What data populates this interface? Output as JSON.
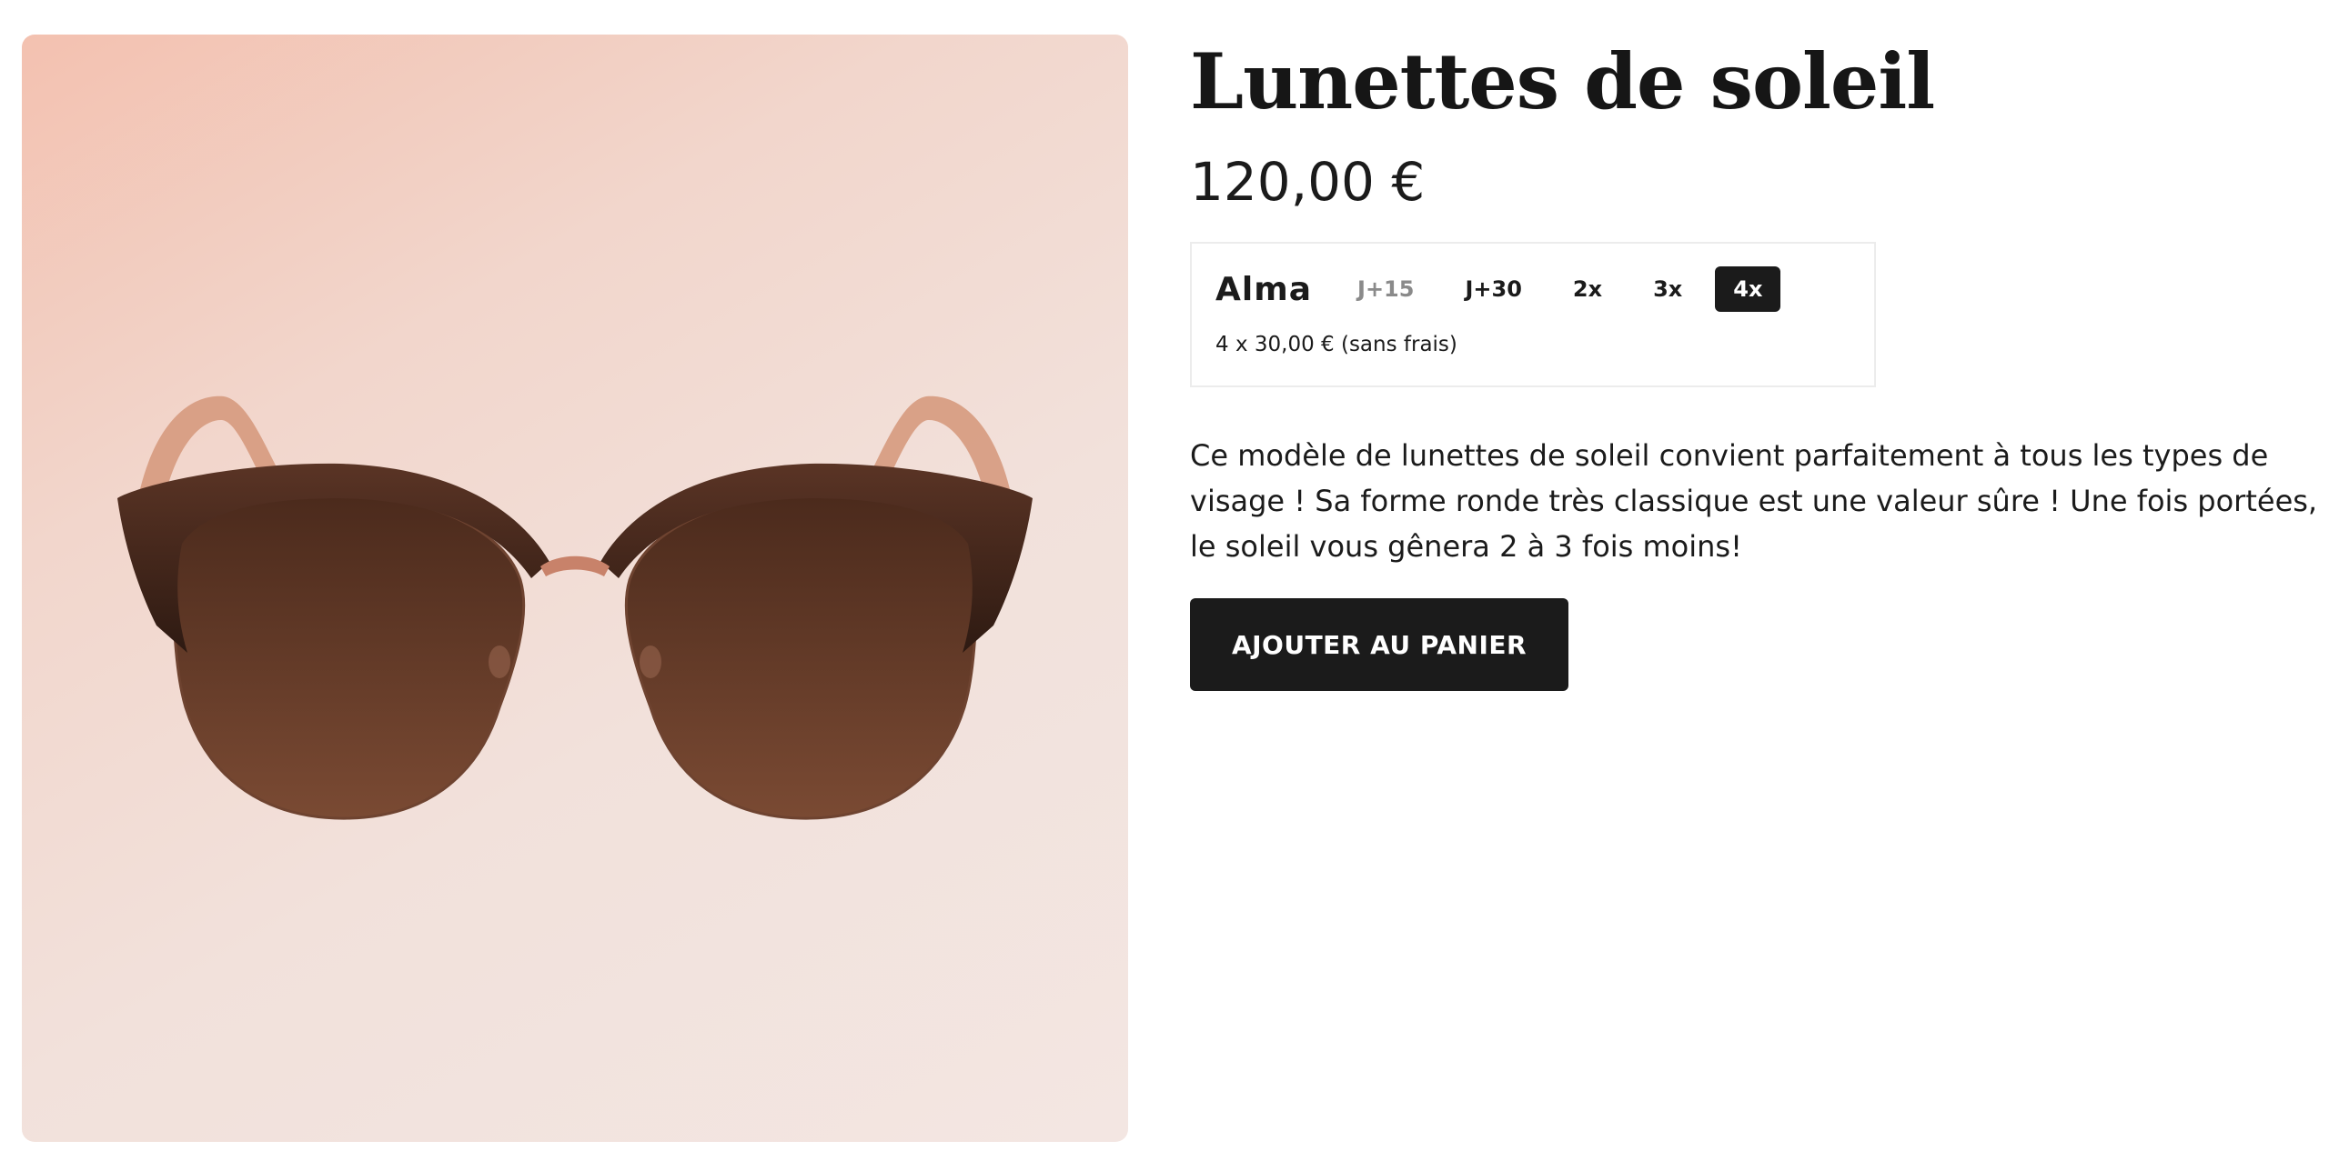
{
  "product": {
    "title": "Lunettes de soleil",
    "price": "120,00 €",
    "image_icon": "sunglasses-image",
    "description": "Ce modèle de lunettes de soleil convient parfaitement à tous les types de visage ! Sa forme ronde très classique est une valeur sûre ! Une fois portées, le soleil vous gênera 2 à 3 fois moins!"
  },
  "alma": {
    "logo": "Alma",
    "plans": [
      "J+15",
      "J+30",
      "2x",
      "3x",
      "4x"
    ],
    "selected_plan": "4x",
    "summary": "4 x 30,00 € (sans frais)"
  },
  "cart": {
    "add_label": "AJOUTER AU PANIER"
  },
  "colors": {
    "accent": "#1b1b1b",
    "background_gradient_start": "#f3c1b0",
    "background_gradient_end": "#f3e6e2"
  }
}
